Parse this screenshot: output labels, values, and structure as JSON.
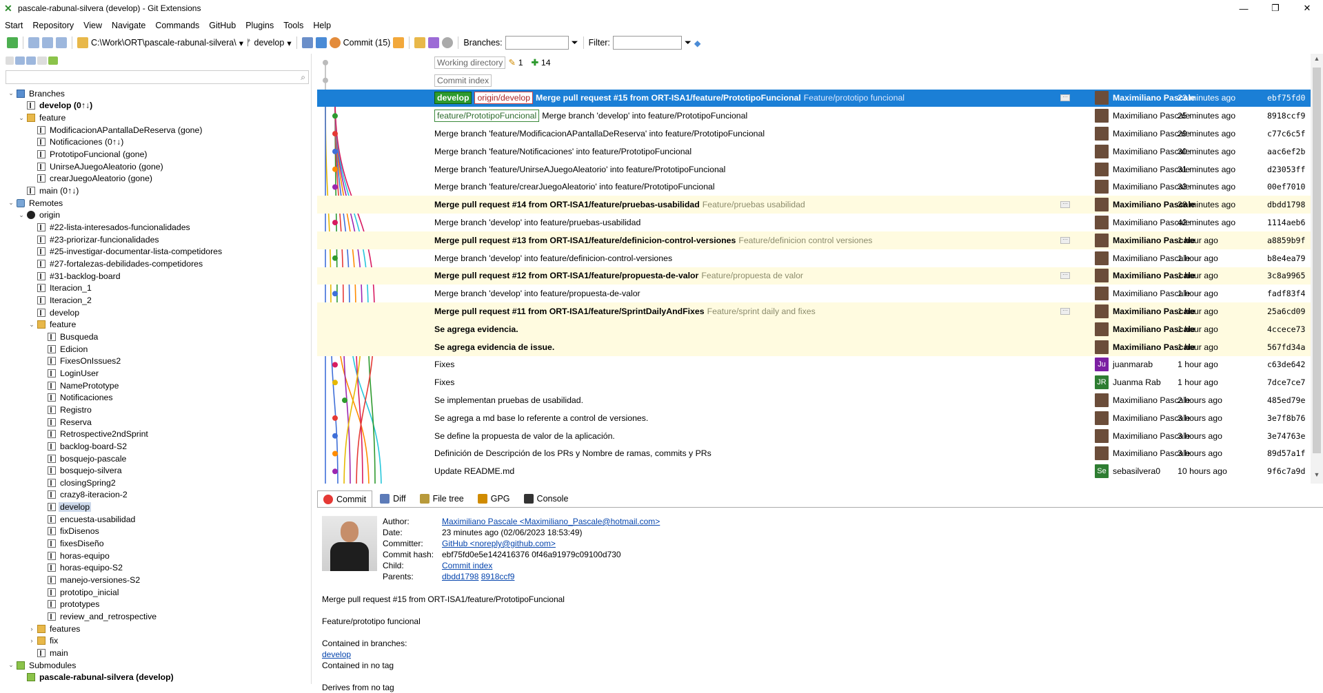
{
  "window": {
    "title": "pascale-rabunal-silvera (develop) - Git Extensions"
  },
  "menu": [
    "Start",
    "Repository",
    "View",
    "Navigate",
    "Commands",
    "GitHub",
    "Plugins",
    "Tools",
    "Help"
  ],
  "toolbar": {
    "path": "C:\\Work\\ORT\\pascale-rabunal-silvera\\",
    "branch": "develop",
    "commit_label": "Commit (15)",
    "branches_label": "Branches:",
    "filter_label": "Filter:"
  },
  "tree": [
    {
      "level": 0,
      "toggle": "down",
      "icon": "computer",
      "label": "Branches"
    },
    {
      "level": 1,
      "toggle": "",
      "icon": "branch",
      "label": "develop (0↑↓)",
      "bold": true
    },
    {
      "level": 1,
      "toggle": "down",
      "icon": "folderbr",
      "label": "feature"
    },
    {
      "level": 2,
      "toggle": "",
      "icon": "branch",
      "label": "ModificacionAPantallaDeReserva (gone)"
    },
    {
      "level": 2,
      "toggle": "",
      "icon": "branch",
      "label": "Notificaciones (0↑↓)"
    },
    {
      "level": 2,
      "toggle": "",
      "icon": "branch",
      "label": "PrototipoFuncional (gone)"
    },
    {
      "level": 2,
      "toggle": "",
      "icon": "branch",
      "label": "UnirseAJuegoAleatorio (gone)"
    },
    {
      "level": 2,
      "toggle": "",
      "icon": "branch",
      "label": "crearJuegoAleatorio (gone)"
    },
    {
      "level": 1,
      "toggle": "",
      "icon": "branch",
      "label": "main (0↑↓)"
    },
    {
      "level": 0,
      "toggle": "down",
      "icon": "remote",
      "label": "Remotes"
    },
    {
      "level": 1,
      "toggle": "down",
      "icon": "github",
      "label": "origin"
    },
    {
      "level": 2,
      "toggle": "",
      "icon": "branch",
      "label": "#22-lista-interesados-funcionalidades"
    },
    {
      "level": 2,
      "toggle": "",
      "icon": "branch",
      "label": "#23-priorizar-funcionalidades"
    },
    {
      "level": 2,
      "toggle": "",
      "icon": "branch",
      "label": "#25-investigar-documentar-lista-competidores"
    },
    {
      "level": 2,
      "toggle": "",
      "icon": "branch",
      "label": "#27-fortalezas-debilidades-competidores"
    },
    {
      "level": 2,
      "toggle": "",
      "icon": "branch",
      "label": "#31-backlog-board"
    },
    {
      "level": 2,
      "toggle": "",
      "icon": "branch",
      "label": "Iteracion_1"
    },
    {
      "level": 2,
      "toggle": "",
      "icon": "branch",
      "label": "Iteracion_2"
    },
    {
      "level": 2,
      "toggle": "",
      "icon": "branch",
      "label": "develop"
    },
    {
      "level": 2,
      "toggle": "down",
      "icon": "folderbr",
      "label": "feature"
    },
    {
      "level": 3,
      "toggle": "",
      "icon": "branch",
      "label": "Busqueda"
    },
    {
      "level": 3,
      "toggle": "",
      "icon": "branch",
      "label": "Edicion"
    },
    {
      "level": 3,
      "toggle": "",
      "icon": "branch",
      "label": "FixesOnIssues2"
    },
    {
      "level": 3,
      "toggle": "",
      "icon": "branch",
      "label": "LoginUser"
    },
    {
      "level": 3,
      "toggle": "",
      "icon": "branch",
      "label": "NamePrototype"
    },
    {
      "level": 3,
      "toggle": "",
      "icon": "branch",
      "label": "Notificaciones"
    },
    {
      "level": 3,
      "toggle": "",
      "icon": "branch",
      "label": "Registro"
    },
    {
      "level": 3,
      "toggle": "",
      "icon": "branch",
      "label": "Reserva"
    },
    {
      "level": 3,
      "toggle": "",
      "icon": "branch",
      "label": "Retrospective2ndSprint"
    },
    {
      "level": 3,
      "toggle": "",
      "icon": "branch",
      "label": "backlog-board-S2"
    },
    {
      "level": 3,
      "toggle": "",
      "icon": "branch",
      "label": "bosquejo-pascale"
    },
    {
      "level": 3,
      "toggle": "",
      "icon": "branch",
      "label": "bosquejo-silvera"
    },
    {
      "level": 3,
      "toggle": "",
      "icon": "branch",
      "label": "closingSpring2"
    },
    {
      "level": 3,
      "toggle": "",
      "icon": "branch",
      "label": "crazy8-iteracion-2"
    },
    {
      "level": 3,
      "toggle": "",
      "icon": "branch",
      "label": "develop",
      "selected": true
    },
    {
      "level": 3,
      "toggle": "",
      "icon": "branch",
      "label": "encuesta-usabilidad"
    },
    {
      "level": 3,
      "toggle": "",
      "icon": "branch",
      "label": "fixDisenos"
    },
    {
      "level": 3,
      "toggle": "",
      "icon": "branch",
      "label": "fixesDiseño"
    },
    {
      "level": 3,
      "toggle": "",
      "icon": "branch",
      "label": "horas-equipo"
    },
    {
      "level": 3,
      "toggle": "",
      "icon": "branch",
      "label": "horas-equipo-S2"
    },
    {
      "level": 3,
      "toggle": "",
      "icon": "branch",
      "label": "manejo-versiones-S2"
    },
    {
      "level": 3,
      "toggle": "",
      "icon": "branch",
      "label": "prototipo_inicial"
    },
    {
      "level": 3,
      "toggle": "",
      "icon": "branch",
      "label": "prototypes"
    },
    {
      "level": 3,
      "toggle": "",
      "icon": "branch",
      "label": "review_and_retrospective"
    },
    {
      "level": 2,
      "toggle": "right",
      "icon": "folderbr",
      "label": "features"
    },
    {
      "level": 2,
      "toggle": "right",
      "icon": "folderbr",
      "label": "fix"
    },
    {
      "level": 2,
      "toggle": "",
      "icon": "branch",
      "label": "main"
    },
    {
      "level": 0,
      "toggle": "down",
      "icon": "sub",
      "label": "Submodules"
    },
    {
      "level": 1,
      "toggle": "",
      "icon": "sub",
      "label": "pascale-rabunal-silvera (develop)",
      "bold": true
    }
  ],
  "working": {
    "wd_label": "Working directory",
    "wd_modified": "1",
    "wd_added": "14",
    "ci_label": "Commit index"
  },
  "commits": [
    {
      "tags": [
        {
          "t": "develop",
          "k": "local"
        },
        {
          "t": "origin/develop",
          "k": "remote"
        }
      ],
      "msg": "Merge pull request #15 from ORT-ISA1/feature/PrototipoFuncional",
      "sub": "Feature/prototipo funcional",
      "author": "Maximiliano Pascale",
      "time": "23 minutes ago",
      "hash": "ebf75fd0",
      "selected": true,
      "bold": true,
      "dots": true
    },
    {
      "tags": [
        {
          "t": "feature/PrototipoFuncional",
          "k": "branch"
        }
      ],
      "msg": "Merge branch 'develop' into feature/PrototipoFuncional",
      "sub": "",
      "author": "Maximiliano Pascale",
      "time": "25 minutes ago",
      "hash": "8918ccf9"
    },
    {
      "tags": [],
      "msg": "Merge branch 'feature/ModificacionAPantallaDeReserva' into feature/PrototipoFuncional",
      "sub": "",
      "author": "Maximiliano Pascale",
      "time": "29 minutes ago",
      "hash": "c77c6c5f"
    },
    {
      "tags": [],
      "msg": "Merge branch 'feature/Notificaciones' into feature/PrototipoFuncional",
      "sub": "",
      "author": "Maximiliano Pascale",
      "time": "30 minutes ago",
      "hash": "aac6ef2b"
    },
    {
      "tags": [],
      "msg": "Merge branch 'feature/UnirseAJuegoAleatorio' into feature/PrototipoFuncional",
      "sub": "",
      "author": "Maximiliano Pascale",
      "time": "31 minutes ago",
      "hash": "d23053ff"
    },
    {
      "tags": [],
      "msg": "Merge branch 'feature/crearJuegoAleatorio' into feature/PrototipoFuncional",
      "sub": "",
      "author": "Maximiliano Pascale",
      "time": "33 minutes ago",
      "hash": "00ef7010"
    },
    {
      "tags": [],
      "msg": "Merge pull request #14 from ORT-ISA1/feature/pruebas-usabilidad",
      "sub": "Feature/pruebas usabilidad",
      "author": "Maximiliano Pascale",
      "time": "38 minutes ago",
      "hash": "dbdd1798",
      "hi": true,
      "bold": true,
      "dots": true
    },
    {
      "tags": [],
      "msg": "Merge branch 'develop' into feature/pruebas-usabilidad",
      "sub": "",
      "author": "Maximiliano Pascale",
      "time": "42 minutes ago",
      "hash": "1114aeb6"
    },
    {
      "tags": [],
      "msg": "Merge pull request #13 from ORT-ISA1/feature/definicion-control-versiones",
      "sub": "Feature/definicion control versiones",
      "author": "Maximiliano Pascale",
      "time": "1 hour ago",
      "hash": "a8859b9f",
      "hi": true,
      "bold": true,
      "dots": true
    },
    {
      "tags": [],
      "msg": "Merge branch 'develop' into feature/definicion-control-versiones",
      "sub": "",
      "author": "Maximiliano Pascale",
      "time": "1 hour ago",
      "hash": "b8e4ea79"
    },
    {
      "tags": [],
      "msg": "Merge pull request #12 from ORT-ISA1/feature/propuesta-de-valor",
      "sub": "Feature/propuesta de valor",
      "author": "Maximiliano Pascale",
      "time": "1 hour ago",
      "hash": "3c8a9965",
      "hi": true,
      "bold": true,
      "dots": true
    },
    {
      "tags": [],
      "msg": "Merge branch 'develop' into feature/propuesta-de-valor",
      "sub": "",
      "author": "Maximiliano Pascale",
      "time": "1 hour ago",
      "hash": "fadf83f4"
    },
    {
      "tags": [],
      "msg": "Merge pull request #11 from ORT-ISA1/feature/SprintDailyAndFixes",
      "sub": "Feature/sprint daily and fixes",
      "author": "Maximiliano Pascale",
      "time": "1 hour ago",
      "hash": "25a6cd09",
      "hi": true,
      "bold": true,
      "dots": true
    },
    {
      "tags": [],
      "msg": "Se agrega evidencia.",
      "sub": "",
      "author": "Maximiliano Pascale",
      "time": "1 hour ago",
      "hash": "4ccece73",
      "hi": true,
      "bold": true
    },
    {
      "tags": [],
      "msg": "Se agrega evidencia de issue.",
      "sub": "",
      "author": "Maximiliano Pascale",
      "time": "1 hour ago",
      "hash": "567fd34a",
      "hi": true,
      "bold": true
    },
    {
      "tags": [],
      "msg": "Fixes",
      "sub": "",
      "author": "juanmarab",
      "time": "1 hour ago",
      "hash": "c63de642",
      "avatar": "Ju",
      "avcolor": "#7b1fa2"
    },
    {
      "tags": [],
      "msg": "Fixes",
      "sub": "",
      "author": "Juanma Rab",
      "time": "1 hour ago",
      "hash": "7dce7ce7",
      "avatar": "JR",
      "avcolor": "#2e7d32"
    },
    {
      "tags": [],
      "msg": "Se implementan pruebas de usabilidad.",
      "sub": "",
      "author": "Maximiliano Pascale",
      "time": "2 hours ago",
      "hash": "485ed79e"
    },
    {
      "tags": [],
      "msg": "Se agrega a md base lo referente a control de versiones.",
      "sub": "",
      "author": "Maximiliano Pascale",
      "time": "3 hours ago",
      "hash": "3e7f8b76"
    },
    {
      "tags": [],
      "msg": "Se define la propuesta de valor de la aplicación.",
      "sub": "",
      "author": "Maximiliano Pascale",
      "time": "3 hours ago",
      "hash": "3e74763e"
    },
    {
      "tags": [],
      "msg": "Definición de Descripción de los PRs y Nombre de ramas, commits y PRs",
      "sub": "",
      "author": "Maximiliano Pascale",
      "time": "3 hours ago",
      "hash": "89d57a1f"
    },
    {
      "tags": [],
      "msg": "Update README.md",
      "sub": "",
      "author": "sebasilvera0",
      "time": "10 hours ago",
      "hash": "9f6c7a9d",
      "avatar": "Se",
      "avcolor": "#2e7d32"
    }
  ],
  "tabs": [
    "Commit",
    "Diff",
    "File tree",
    "GPG",
    "Console"
  ],
  "detail": {
    "author_k": "Author:",
    "author": "Maximiliano Pascale <Maximiliano_Pascale@hotmail.com>",
    "date_k": "Date:",
    "date": "23 minutes ago (02/06/2023 18:53:49)",
    "committer_k": "Committer:",
    "committer": "GitHub <noreply@github.com>",
    "hash_k": "Commit hash:",
    "hash": "ebf75fd0e5e142416376 0f46a91979c09100d730",
    "child_k": "Child:",
    "child": "Commit index",
    "parents_k": "Parents:",
    "parent1": "dbdd1798",
    "parent2": "8918ccf9",
    "title": "Merge pull request #15 from ORT-ISA1/feature/PrototipoFuncional",
    "desc": "Feature/prototipo funcional",
    "contained_k": "Contained in branches:",
    "contained_branch": "develop",
    "tags_line": "Contained in no tag",
    "derives": "Derives from no tag"
  },
  "colors": {
    "selected": "#1b7fd6",
    "highlight": "#fffbe0",
    "accent": "#2e9a2e"
  }
}
